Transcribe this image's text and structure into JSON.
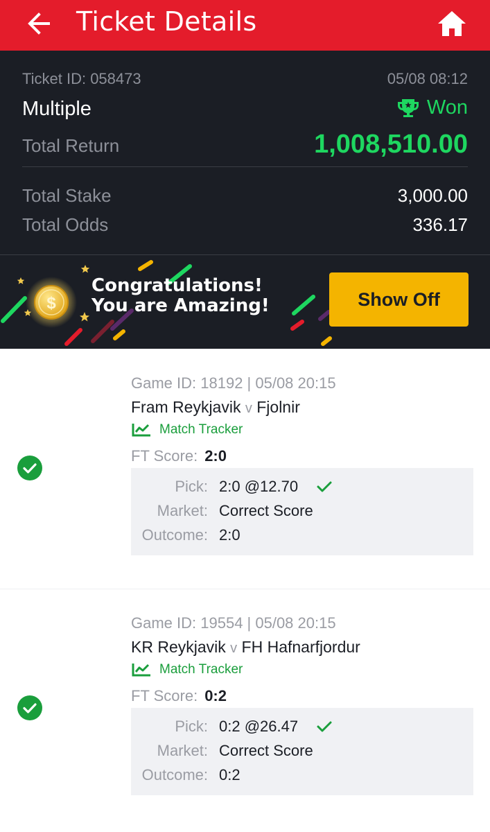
{
  "header": {
    "title": "Ticket Details",
    "back_icon": "arrow-left-icon",
    "home_icon": "home-icon"
  },
  "colors": {
    "header_bg": "#e41c2b",
    "summary_bg": "#1b1e25",
    "win_green": "#1ed760",
    "button_yellow": "#f4b400",
    "tracker_green": "#1a9e3c"
  },
  "ticket": {
    "id_label": "Ticket ID: 058473",
    "datetime": "05/08 08:12",
    "bet_type": "Multiple",
    "status": "Won",
    "status_icon": "trophy-icon",
    "total_return_label": "Total Return",
    "total_return": "1,008,510.00",
    "total_stake_label": "Total Stake",
    "total_stake": "3,000.00",
    "total_odds_label": "Total Odds",
    "total_odds": "336.17"
  },
  "banner": {
    "line1": "Congratulations!",
    "line2": "You are Amazing!",
    "button_label": "Show Off",
    "coin_icon": "dollar-coin-icon"
  },
  "games": [
    {
      "game_id": "Game ID: 18192 | 05/08 20:15",
      "home": "Fram Reykjavik",
      "vs": "v",
      "away": "Fjolnir",
      "tracker_label": "Match Tracker",
      "ft_label": "FT Score:",
      "ft_score": "2:0",
      "pick_label": "Pick:",
      "pick": "2:0 @12.70",
      "market_label": "Market:",
      "market": "Correct Score",
      "outcome_label": "Outcome:",
      "outcome": "2:0"
    },
    {
      "game_id": "Game ID: 19554 | 05/08 20:15",
      "home": "KR Reykjavik",
      "vs": "v",
      "away": "FH Hafnarfjordur",
      "tracker_label": "Match Tracker",
      "ft_label": "FT Score:",
      "ft_score": "0:2",
      "pick_label": "Pick:",
      "pick": "0:2 @26.47",
      "market_label": "Market:",
      "market": "Correct Score",
      "outcome_label": "Outcome:",
      "outcome": "0:2"
    }
  ]
}
